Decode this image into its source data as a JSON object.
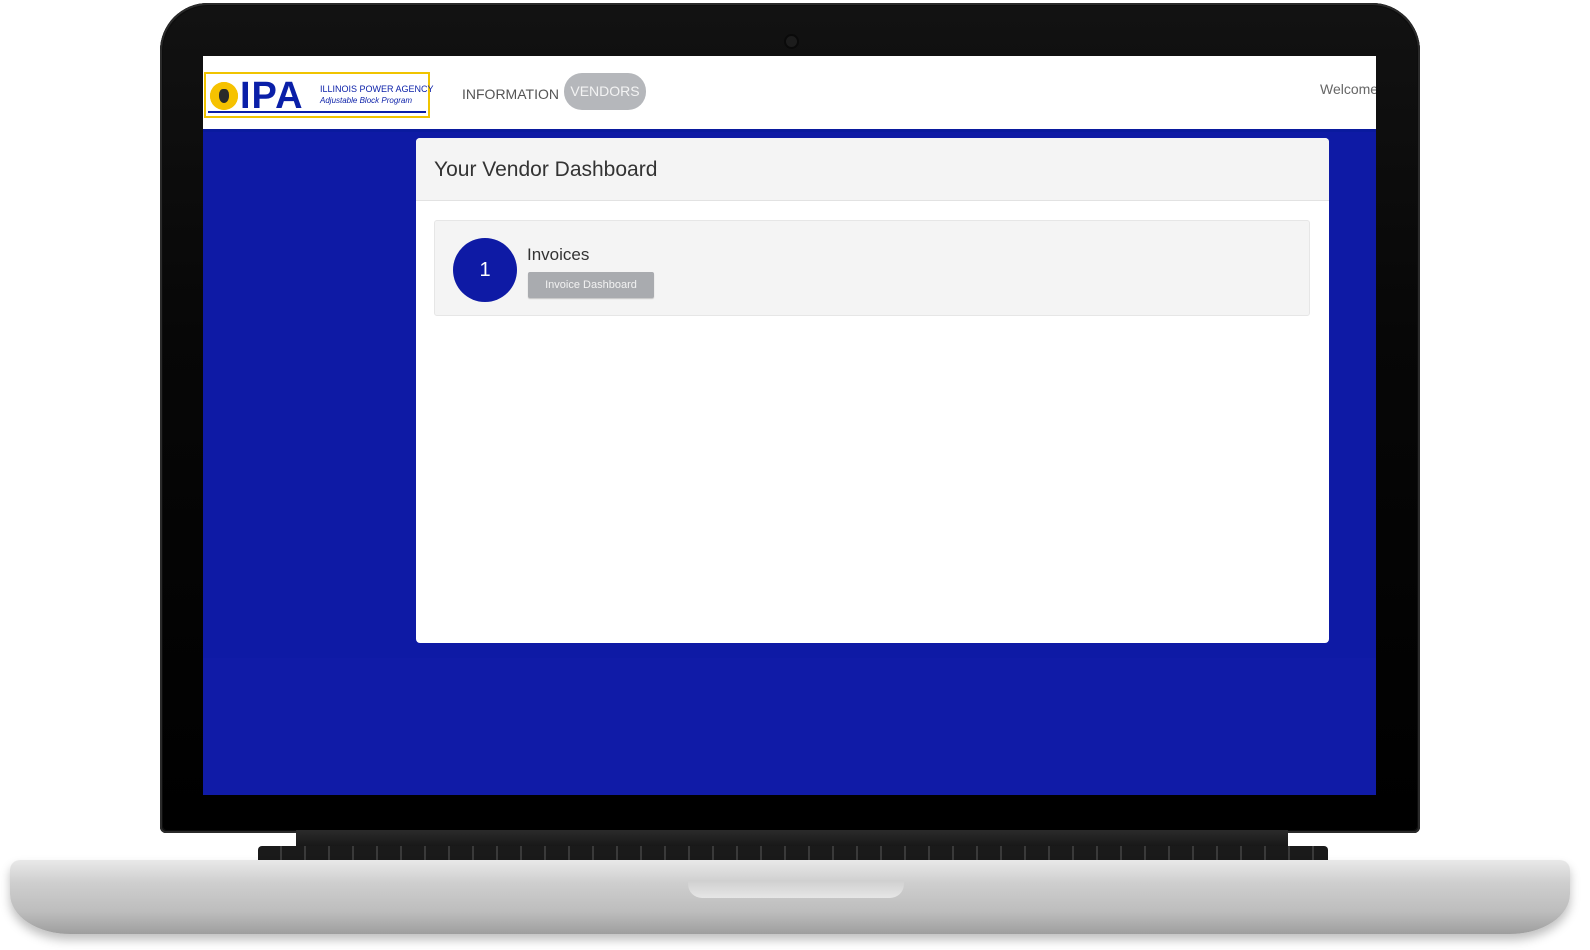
{
  "logo": {
    "acronym": "IPA",
    "line1": "ILLINOIS POWER AGENCY",
    "line2": "Adjustable Block Program"
  },
  "nav": {
    "items": [
      {
        "label": "INFORMATION",
        "active": false
      },
      {
        "label": "VENDORS",
        "active": true
      }
    ],
    "welcome": "Welcome"
  },
  "dashboard": {
    "title": "Your Vendor Dashboard",
    "tiles": [
      {
        "count": "1",
        "title": "Invoices",
        "button_label": "Invoice Dashboard"
      }
    ]
  },
  "colors": {
    "brand_blue": "#0e1aa5",
    "logo_yellow": "#f0c400",
    "active_nav_bg": "#b5b7bb",
    "button_gray": "#a9abaf"
  }
}
